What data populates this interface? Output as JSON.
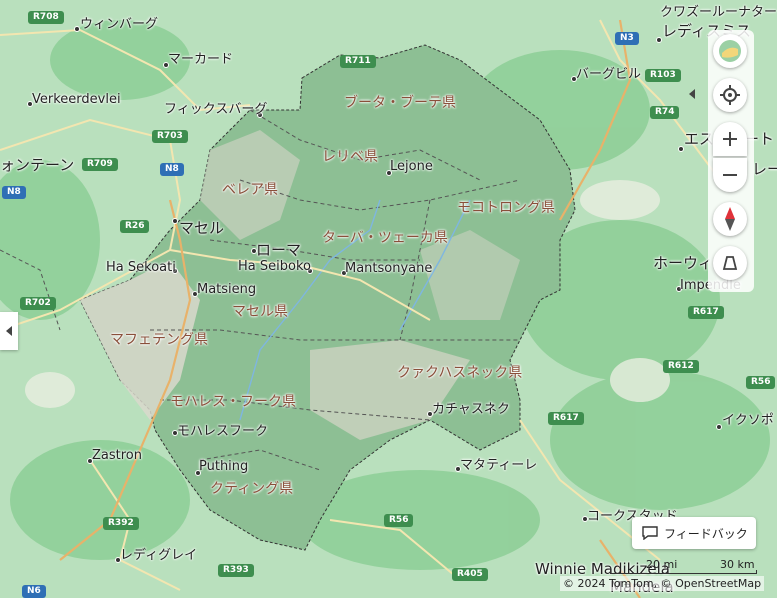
{
  "colors": {
    "background": "#a8d8b0",
    "forest": "#7fc48c",
    "lesotho_fill": "#c8cfc2",
    "accent": "#2f6fb5"
  },
  "labels": {
    "winburg": "ウィンバーグ",
    "marquard": "マーカード",
    "verkeerdevlei": "Verkeerdevlei",
    "ficksburg": "フィックスバーグ",
    "bloemfontein": "ォンテーン",
    "maseru": "マセル",
    "ha_sekoati": "Ha Sekoati",
    "roma": "ローマ",
    "ha_seiboko": "Ha Seiboko",
    "matsieng": "Matsieng",
    "mantsonyane": "Mantsonyane",
    "lejone": "Lejone",
    "qachas_nek": "カチャスネク",
    "matatiele": "マタティーレ",
    "mohales_hoek": "モハレスフーク",
    "puthing": "Puthing",
    "zastron": "Zastron",
    "ladygrey": "レディグレイ",
    "kokstad": "コークスタッド",
    "winnie": "Winnie Madikizela",
    "ixopo": "イクソポ",
    "impendle": "Impendle",
    "howick": "ホーウィ",
    "bergville": "バーグビル",
    "ladysmith": "レディスミス",
    "kwazulu": "クワズールーナター",
    "estcourt": "エストコート",
    "mandela": "Mandela",
    "re": "レー"
  },
  "provinces": {
    "butha_buthe": "ブータ・ブーテ県",
    "leribe": "レリベ県",
    "berea": "ベレア県",
    "mokhotlong": "モコトロング県",
    "thaba_tseka": "ターバ・ツェーカ県",
    "maseru": "マセル県",
    "mafeteng": "マフェテング県",
    "qachas_nek": "クァクハスネック県",
    "mohales_hoek": "モハレス・フーク県",
    "quthing": "クティング県"
  },
  "roads": {
    "r708": "R708",
    "r711": "R711",
    "r703": "R703",
    "r709": "R709",
    "n8a": "N8",
    "n8b": "N8",
    "r26": "R26",
    "r702": "R702",
    "n3": "N3",
    "r103": "R103",
    "r74": "R74",
    "r617a": "R617",
    "r612": "R612",
    "r56a": "R56",
    "r617b": "R617",
    "r56b": "R56",
    "r392": "R392",
    "r393": "R393",
    "r405": "R405",
    "n6": "N6"
  },
  "ui": {
    "feedback": "フィードバック",
    "scale_mi": "20 mi",
    "scale_km": "30 km",
    "attribution": "© 2024 TomTom, © OpenStreetMap"
  },
  "icons": {
    "layers": "map-layers-icon",
    "locate": "locate-icon",
    "zoom_in": "plus-icon",
    "zoom_out": "minus-icon",
    "compass": "compass-icon",
    "tilt": "tilt-icon",
    "feedback": "speech-bubble-icon",
    "collapse": "chevron-icon"
  }
}
